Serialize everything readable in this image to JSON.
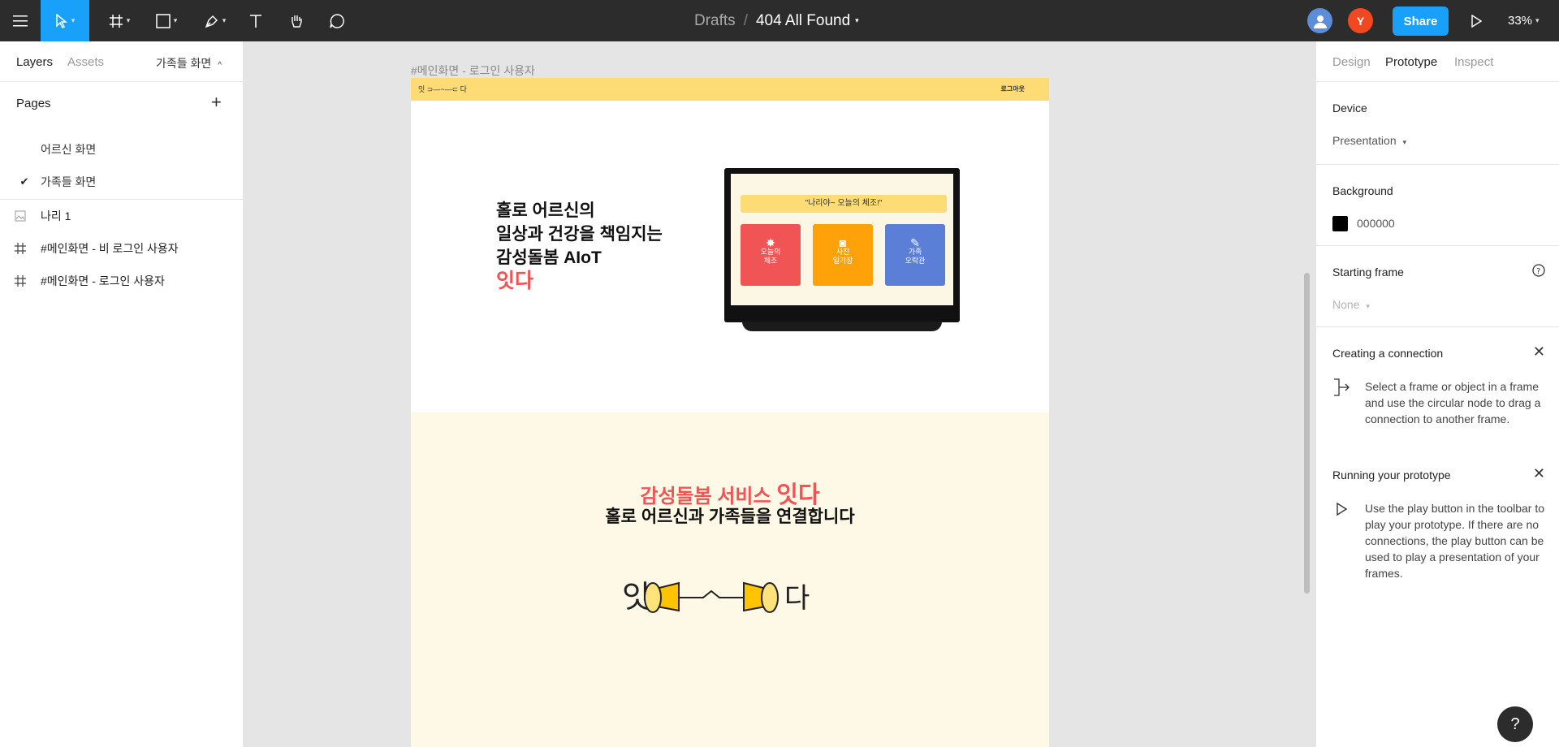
{
  "toolbar": {
    "breadcrumb_parent": "Drafts",
    "breadcrumb_sep": "/",
    "file_name": "404 All Found",
    "share_label": "Share",
    "zoom": "33%",
    "user_initial": "Y",
    "accent_color": "#18a0fb"
  },
  "left_panel": {
    "tab_layers": "Layers",
    "tab_assets": "Assets",
    "current_page": "가족들 화면",
    "pages_title": "Pages",
    "pages": [
      {
        "label": "어르신 화면",
        "selected": false
      },
      {
        "label": "가족들 화면",
        "selected": true
      }
    ],
    "layers": [
      {
        "label": "나리 1",
        "icon": "image-icon"
      },
      {
        "label": "#메인화면 - 비 로그인 사용자",
        "icon": "frame-icon"
      },
      {
        "label": "#메인화면 - 로그인 사용자",
        "icon": "frame-icon"
      }
    ]
  },
  "right_panel": {
    "tab_design": "Design",
    "tab_prototype": "Prototype",
    "tab_inspect": "Inspect",
    "device_title": "Device",
    "device_value": "Presentation",
    "background_title": "Background",
    "background_value": "000000",
    "starting_frame_title": "Starting frame",
    "starting_frame_value": "None",
    "connection_title": "Creating a connection",
    "connection_desc": "Select a frame or object in a frame and use the circular node to drag a connection to another frame.",
    "running_title": "Running your prototype",
    "running_desc": "Use the play button in the toolbar to play your prototype. If there are no connections, the play button can be used to play a presentation of your frames."
  },
  "canvas": {
    "frame_label": "#메인화면 - 로그인 사용자",
    "header_logo": "잇 ⊃—~—⊂ 다",
    "header_login": "로그아웃",
    "hero_line1": "홀로 어르신의",
    "hero_line2": "일상과 건강을 책임지는",
    "hero_line3": "감성돌봄 AIoT",
    "hero_brand": "잇다",
    "tv_banner": "\"나리야~ 오늘의 체조!\"",
    "tv_cards": [
      {
        "label1": "오늘의",
        "label2": "체조",
        "color": "#f05454"
      },
      {
        "label1": "사진",
        "label2": "일기장",
        "color": "#ffa20a"
      },
      {
        "label1": "가족",
        "label2": "오락관",
        "color": "#5b7fd6"
      }
    ],
    "service_line1_a": "감성돌봄 서비스",
    "service_line1_b": "잇다",
    "service_line2": "홀로 어르신과 가족들을 연결합니다",
    "logo_left": "잇",
    "logo_right": "다"
  },
  "help_label": "?"
}
